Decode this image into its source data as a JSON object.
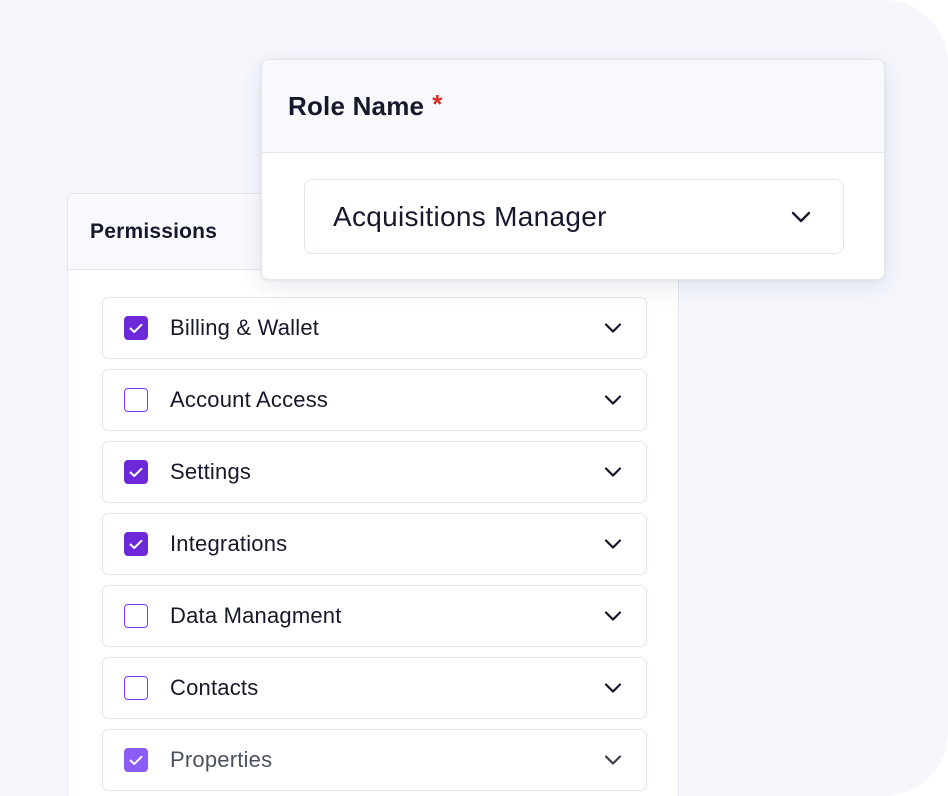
{
  "permissions": {
    "title": "Permissions",
    "items": [
      {
        "label": "Billing & Wallet",
        "checked": true
      },
      {
        "label": "Account Access",
        "checked": false
      },
      {
        "label": "Settings",
        "checked": true
      },
      {
        "label": "Integrations",
        "checked": true
      },
      {
        "label": "Data Managment",
        "checked": false
      },
      {
        "label": "Contacts",
        "checked": false
      },
      {
        "label": "Properties",
        "checked": true
      }
    ]
  },
  "role": {
    "title": "Role Name",
    "required_marker": "*",
    "selected_value": "Acquisitions Manager"
  },
  "icons": {
    "check": "check-icon",
    "chevron": "chevron-down-icon"
  },
  "colors": {
    "accent": "#6d28d9",
    "required": "#d92d20",
    "background": "#f5f7fd"
  }
}
